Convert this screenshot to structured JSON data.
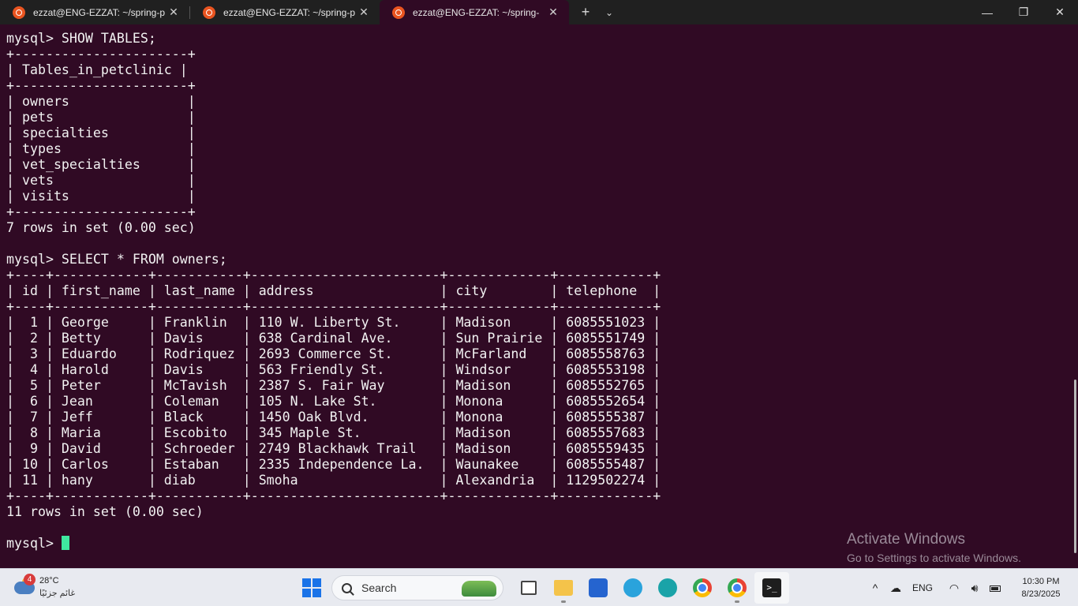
{
  "tabs": [
    {
      "title": "ezzat@ENG-EZZAT: ~/spring-p",
      "active": false
    },
    {
      "title": "ezzat@ENG-EZZAT: ~/spring-p",
      "active": false
    },
    {
      "title": "ezzat@ENG-EZZAT: ~/spring-",
      "active": true
    }
  ],
  "tab_actions": {
    "new_tab": "+",
    "dropdown": "⌄"
  },
  "window_controls": {
    "minimize": "—",
    "maximize": "❐",
    "close": "✕"
  },
  "terminal": {
    "lines": [
      "mysql> SHOW TABLES;",
      "+----------------------+",
      "| Tables_in_petclinic |",
      "+----------------------+",
      "| owners               |",
      "| pets                 |",
      "| specialties          |",
      "| types                |",
      "| vet_specialties      |",
      "| vets                 |",
      "| visits               |",
      "+----------------------+",
      "7 rows in set (0.00 sec)",
      "",
      "mysql> SELECT * FROM owners;",
      "+----+------------+-----------+------------------------+-------------+------------+",
      "| id | first_name | last_name | address                | city        | telephone  |",
      "+----+------------+-----------+------------------------+-------------+------------+",
      "|  1 | George     | Franklin  | 110 W. Liberty St.     | Madison     | 6085551023 |",
      "|  2 | Betty      | Davis     | 638 Cardinal Ave.      | Sun Prairie | 6085551749 |",
      "|  3 | Eduardo    | Rodriquez | 2693 Commerce St.      | McFarland   | 6085558763 |",
      "|  4 | Harold     | Davis     | 563 Friendly St.       | Windsor     | 6085553198 |",
      "|  5 | Peter      | McTavish  | 2387 S. Fair Way       | Madison     | 6085552765 |",
      "|  6 | Jean       | Coleman   | 105 N. Lake St.        | Monona      | 6085552654 |",
      "|  7 | Jeff       | Black     | 1450 Oak Blvd.         | Monona      | 6085555387 |",
      "|  8 | Maria      | Escobito  | 345 Maple St.          | Madison     | 6085557683 |",
      "|  9 | David      | Schroeder | 2749 Blackhawk Trail   | Madison     | 6085559435 |",
      "| 10 | Carlos     | Estaban   | 2335 Independence La.  | Waunakee    | 6085555487 |",
      "| 11 | hany       | diab      | Smoha                  | Alexandria  | 1129502274 |",
      "+----+------------+-----------+------------------------+-------------+------------+",
      "11 rows in set (0.00 sec)",
      ""
    ],
    "prompt": "mysql> ",
    "cursor_color": "#3fe8a0",
    "background": "#300a24"
  },
  "watermark": {
    "line1": "Activate Windows",
    "line2": "Go to Settings to activate Windows."
  },
  "taskbar": {
    "weather": {
      "badge": "4",
      "temp": "28°C",
      "condition": "غائم جزئيًا"
    },
    "search_label": "Search",
    "apps": [
      {
        "name": "task-view"
      },
      {
        "name": "file-explorer"
      },
      {
        "name": "microsoft-store"
      },
      {
        "name": "telegram"
      },
      {
        "name": "arduino"
      },
      {
        "name": "chrome"
      },
      {
        "name": "chrome-profile"
      },
      {
        "name": "terminal",
        "glyph": ">_"
      }
    ],
    "tray": {
      "chevron": "^",
      "language": "ENG",
      "time": "10:30 PM",
      "date": "8/23/2025"
    }
  }
}
